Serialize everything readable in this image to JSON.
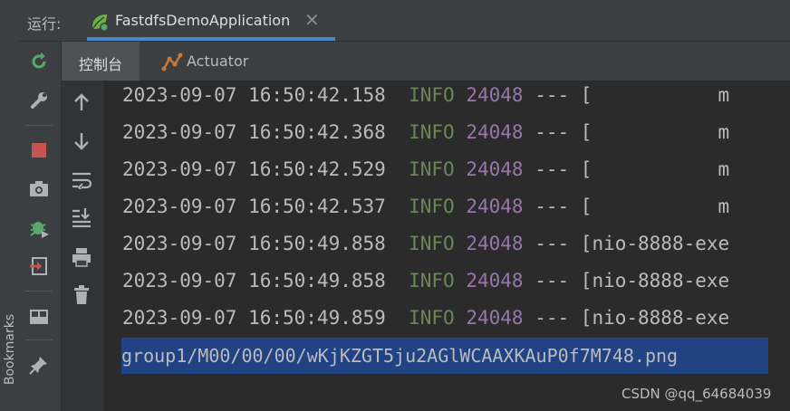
{
  "sidebar": {
    "bookmarks_label": "Bookmarks"
  },
  "run_panel": {
    "title": "运行:",
    "tab_label": "FastdfsDemoApplication",
    "close_glyph": "✕"
  },
  "console_tabs": [
    {
      "label": "控制台",
      "active": true
    },
    {
      "label": "Actuator",
      "active": false
    }
  ],
  "left_toolbar_icons": [
    "rerun-icon",
    "wrench-icon",
    "stop-icon",
    "camera-icon",
    "debug-bug-icon",
    "exit-icon",
    "layout-icon",
    "pin-icon"
  ],
  "console_toolbar_icons": [
    "arrow-up-icon",
    "arrow-down-icon",
    "soft-wrap-icon",
    "scroll-to-end-icon",
    "print-icon",
    "trash-icon"
  ],
  "log_lines": [
    {
      "timestamp": "2023-09-07 16:50:42.158",
      "level": "INFO",
      "pid": "24048",
      "sep": "---",
      "thread": "[           m"
    },
    {
      "timestamp": "2023-09-07 16:50:42.368",
      "level": "INFO",
      "pid": "24048",
      "sep": "---",
      "thread": "[           m"
    },
    {
      "timestamp": "2023-09-07 16:50:42.529",
      "level": "INFO",
      "pid": "24048",
      "sep": "---",
      "thread": "[           m"
    },
    {
      "timestamp": "2023-09-07 16:50:42.537",
      "level": "INFO",
      "pid": "24048",
      "sep": "---",
      "thread": "[           m"
    },
    {
      "timestamp": "2023-09-07 16:50:49.858",
      "level": "INFO",
      "pid": "24048",
      "sep": "---",
      "thread": "[nio-8888-exe"
    },
    {
      "timestamp": "2023-09-07 16:50:49.858",
      "level": "INFO",
      "pid": "24048",
      "sep": "---",
      "thread": "[nio-8888-exe"
    },
    {
      "timestamp": "2023-09-07 16:50:49.859",
      "level": "INFO",
      "pid": "24048",
      "sep": "---",
      "thread": "[nio-8888-exe"
    }
  ],
  "result_line": "group1/M00/00/00/wKjKZGT5ju2AGlWCAAXKAuP0f7M748.png",
  "watermark": "CSDN @qq_64684039",
  "colors": {
    "background": "#2b2b2b",
    "panel": "#3c3f41",
    "accent_underline": "#4a88c7",
    "info_level": "#6a8759",
    "pid": "#9876aa",
    "selection": "#214283",
    "stop": "#c75450",
    "rerun": "#59a869"
  }
}
